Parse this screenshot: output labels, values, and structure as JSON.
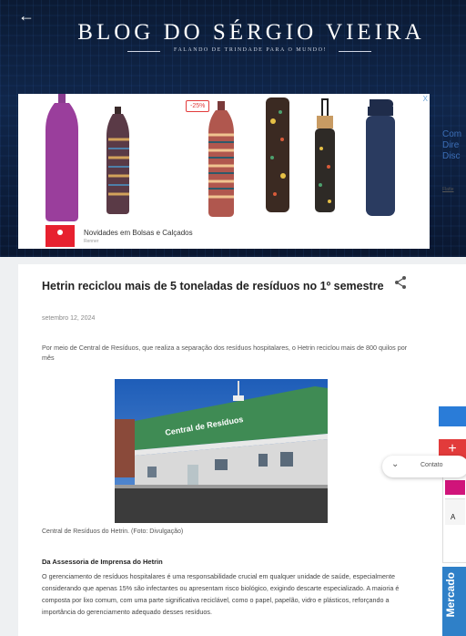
{
  "blog": {
    "title": "BLOG DO SÉRGIO VIEIRA",
    "tagline": "FALANDO DE TRINDADE PARA O MUNDO!"
  },
  "ad": {
    "discount_badge": "-25%",
    "close_label": "X",
    "headline": "Novidades em Bolsas e Calçados",
    "source": "Renner"
  },
  "sidebar": {
    "link_text": "Com Dire Disc",
    "small_link": "Flatte",
    "card_label": "A"
  },
  "post": {
    "title": "Hetrin reciclou mais de 5 toneladas de resíduos no 1º semestre",
    "date": "setembro 12, 2024",
    "intro": "Por meio de Central de Resíduos, que realiza a separação dos resíduos hospitalares, o Hetrin reciclou mais de 800 quilos por mês",
    "photo_sign": "Central de Resíduos",
    "caption": "Central de Resíduos do Hetrin. (Foto: Divulgação)",
    "byline": "Da Assessoria de Imprensa do Hetrin",
    "body": "O gerenciamento de resíduos hospitalares é uma responsabilidade crucial em qualquer unidade de saúde, especialmente considerando que apenas 15% são infectantes ou apresentam risco biológico, exigindo descarte especializado. A maioria é composta por lixo comum, com uma parte significativa reciclável, como o papel, papelão, vidro e plásticos, reforçando a importância do gerenciamento adequado desses resíduos."
  },
  "share_pill": {
    "text": "Contato"
  },
  "colors": {
    "banner": "#0b1a33",
    "ad_brand": "#e7212f",
    "link": "#3b6db5"
  }
}
